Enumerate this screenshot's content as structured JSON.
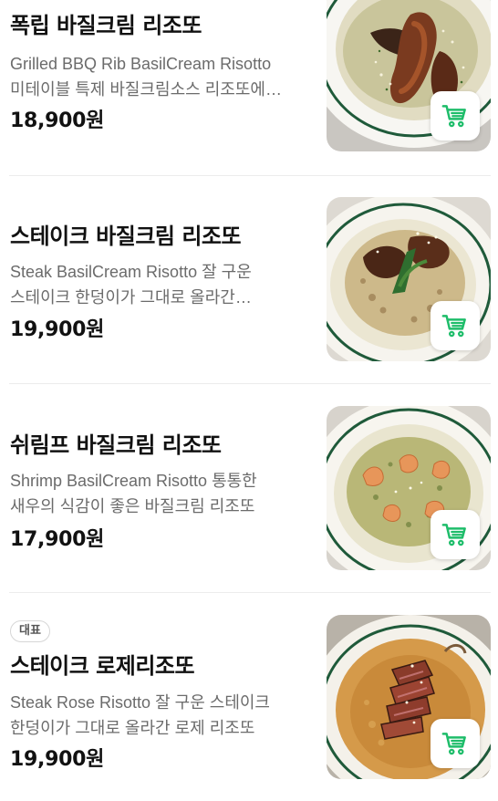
{
  "colors": {
    "accent_green": "#1ebd6a",
    "title_text": "#111111",
    "desc_text": "#6b6b6b",
    "divider": "#ececec"
  },
  "menu": {
    "items": [
      {
        "badge": "",
        "name": "폭립 바질크림 리조또",
        "description": "Grilled BBQ Rib BasilCream Risotto 미테이블 특제 바질크림소스 리조또에 바베큐 폭립을 올린 메뉴",
        "price": "18,900원",
        "cart_icon": "cart-icon"
      },
      {
        "badge": "",
        "name": "스테이크 바질크림 리조또",
        "description": "Steak BasilCream Risotto 잘 구운 스테이크 한덩이가 그대로 올라간 바질크림 리조또",
        "price": "19,900원",
        "cart_icon": "cart-icon"
      },
      {
        "badge": "",
        "name": "쉬림프 바질크림 리조또",
        "description": "Shrimp BasilCream Risotto 통통한 새우의 식감이 좋은 바질크림 리조또",
        "price": "17,900원",
        "cart_icon": "cart-icon"
      },
      {
        "badge": "대표",
        "name": "스테이크 로제리조또",
        "description": "Steak Rose Risotto 잘 구운 스테이크 한덩이가 그대로 올라간 로제 리조또",
        "price": "19,900원",
        "cart_icon": "cart-icon"
      }
    ]
  }
}
